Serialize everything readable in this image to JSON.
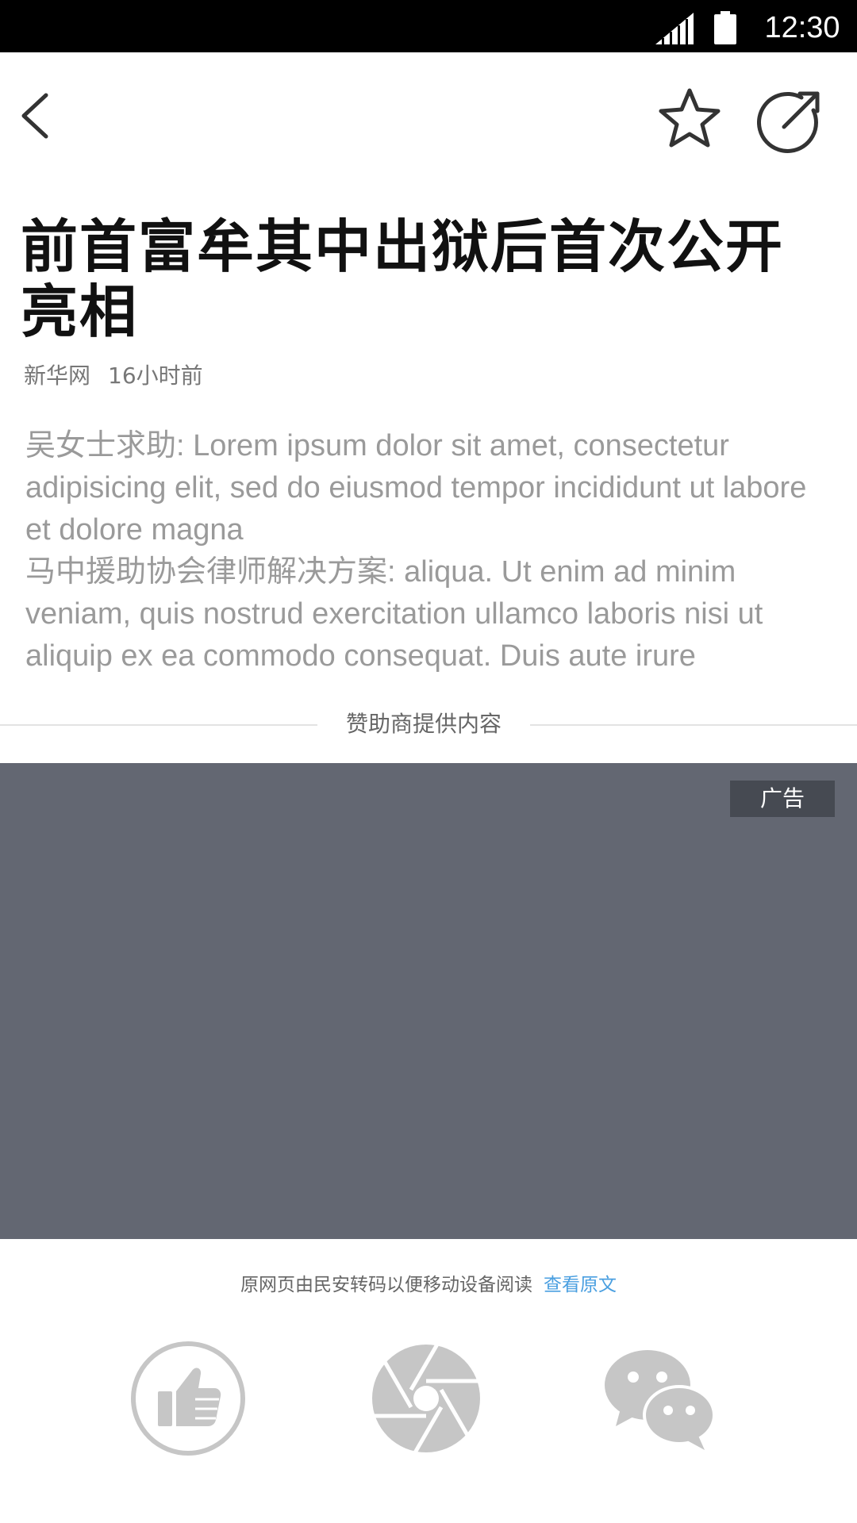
{
  "status_bar": {
    "time": "12:30",
    "icons": [
      "signal-icon",
      "battery-icon"
    ]
  },
  "nav": {
    "icons": [
      "back-arrow-icon",
      "star-icon",
      "share-icon"
    ]
  },
  "article": {
    "title": "前首富牟其中出狱后首次公开亮相",
    "source": "新华网",
    "time": "16小时前",
    "paragraphs": [
      "吴女士求助: Lorem ipsum dolor sit amet, consectetur adipisicing elit, sed do eiusmod tempor incididunt ut labore et dolore magna",
      "马中援助协会律师解决方案: aliqua. Ut enim ad minim veniam, quis nostrud exercitation ullamco laboris nisi ut aliquip ex ea commodo consequat. Duis aute irure"
    ]
  },
  "sponsor": {
    "label": "赞助商提供内容",
    "ad_badge": "广告"
  },
  "footer": {
    "note": "原网页由民安转码以便移动设备阅读",
    "view_original": "查看原文"
  },
  "actions": {
    "icons": [
      "thumbs-up-icon",
      "moments-aperture-icon",
      "wechat-icon"
    ]
  },
  "colors": {
    "status_bar": "#000000",
    "ad_background": "#636772",
    "ad_badge": "#464a52",
    "link": "#4a9fe0",
    "icon_gray": "#c6c6c6"
  }
}
